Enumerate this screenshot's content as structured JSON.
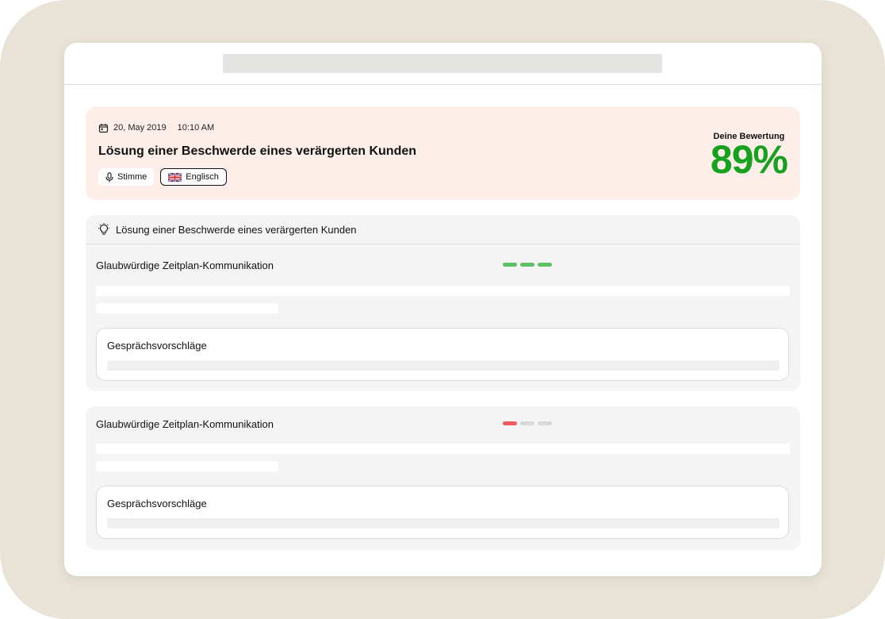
{
  "header": {
    "date": "20, May 2019",
    "time": "10:10 AM",
    "title": "Lösung einer Beschwerde eines verärgerten Kunden",
    "chips": [
      {
        "label": "Stimme",
        "icon": "microphone-icon"
      },
      {
        "label": "Englisch",
        "icon": "uk-flag-icon"
      }
    ],
    "score_label": "Deine Bewertung",
    "score_value": "89%"
  },
  "section": {
    "header_title": "Lösung einer Beschwerde eines verärgerten Kunden",
    "header_icon": "lightbulb-icon",
    "items": [
      {
        "title": "Glaubwürdige Zeitplan-Kommunikation",
        "rating": {
          "filled": 3,
          "total": 3,
          "color": "#5ec064"
        },
        "suggestions_title": "Gesprächsvorschläge"
      },
      {
        "title": "Glaubwürdige Zeitplan-Kommunikation",
        "rating": {
          "filled": 1,
          "total": 3,
          "color": "#ef5a5f"
        },
        "suggestions_title": "Gesprächsvorschläge"
      }
    ]
  },
  "colors": {
    "score": "#16a11e",
    "hero_bg": "#fdeeea",
    "frame_bg": "#e8e3d6",
    "empty_dot": "#d9d9d9"
  }
}
